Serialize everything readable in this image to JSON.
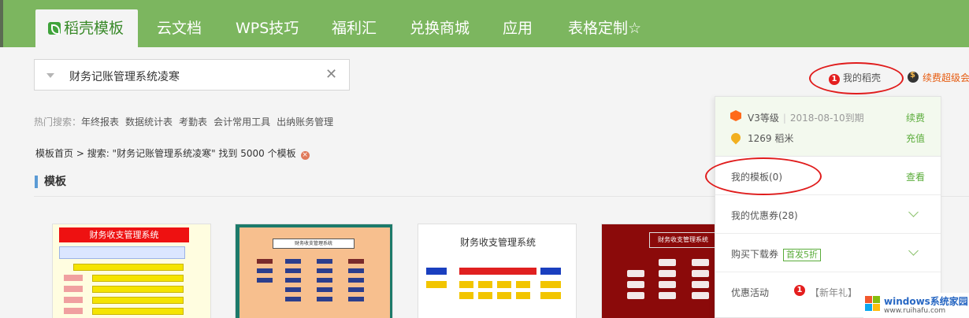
{
  "nav": {
    "tabs": [
      {
        "label": "稻壳模板",
        "active": true
      },
      {
        "label": "云文档"
      },
      {
        "label": "WPS技巧"
      },
      {
        "label": "福利汇"
      },
      {
        "label": "兑换商城"
      },
      {
        "label": "应用"
      },
      {
        "label": "表格定制☆"
      }
    ],
    "accent_color": "#7cb65f"
  },
  "search": {
    "value": "财务记账管理系统凌寒",
    "clear_icon": "close-icon"
  },
  "hot_search": {
    "label": "热门搜索：",
    "items": [
      "年终报表",
      "数据统计表",
      "考勤表",
      "会计常用工具",
      "出纳账务管理"
    ]
  },
  "breadcrumb": {
    "home": "模板首页",
    "sep": " > ",
    "text": "搜索: \"财务记账管理系统凌寒\" 找到 5000 个模板"
  },
  "section": {
    "title": "模板"
  },
  "thumbnails": [
    {
      "title": "财务收支管理系统"
    },
    {
      "title": "财务收支管理系统"
    },
    {
      "title": "财务收支管理系统"
    },
    {
      "title": "财务收支管理系统"
    }
  ],
  "top_right": {
    "my_shell_badge": "1",
    "my_shell": "我的稻壳",
    "renew": "续费超级会"
  },
  "panel": {
    "level": "V3等级",
    "expire": "2018-08-10到期",
    "renew_link": "续费",
    "rice": "1269 稻米",
    "recharge_link": "充值",
    "my_templates": "我的模板(0)",
    "view_link": "查看",
    "coupons": "我的优惠券(28)",
    "buy_downloads": "购买下载券",
    "first_tag": "首发5折",
    "promo": "优惠活动",
    "promo_badge": "1",
    "promo_text": "【新年礼】"
  },
  "watermark": {
    "line1": "windows系统家园",
    "line2": "www.ruihafu.com"
  }
}
